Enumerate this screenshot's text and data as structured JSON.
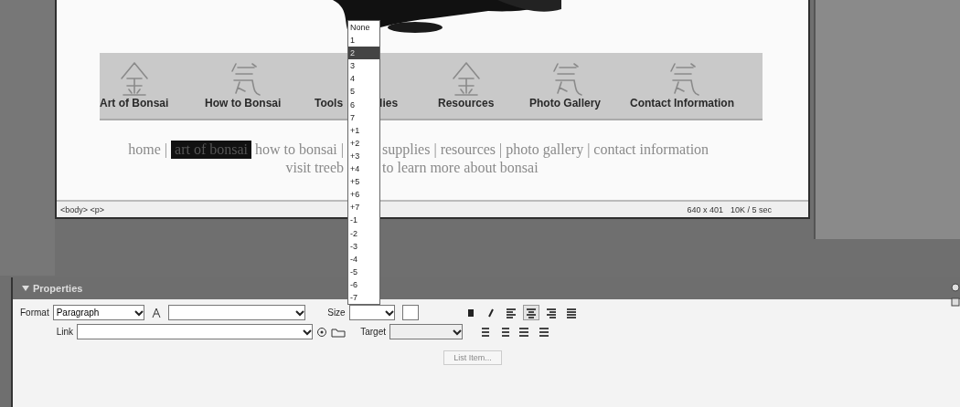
{
  "document": {
    "nav": [
      {
        "label": "Art of Bonsai"
      },
      {
        "label": "How to Bonsai"
      },
      {
        "label": "Tools",
        "tail": "lies"
      },
      {
        "label": "Resources"
      },
      {
        "label": "Photo Gallery"
      },
      {
        "label": "Contact Information"
      }
    ],
    "links_line_1": {
      "before_dropdown": [
        {
          "text": "home |",
          "highlighted": false
        },
        {
          "text": "art of bonsai",
          "highlighted": true
        },
        {
          "text": "how to bonsai |",
          "highlighted": false
        }
      ],
      "after_dropdown": "supplies | resources | photo gallery | contact information"
    },
    "links_line_2": {
      "before_dropdown": "visit treeb",
      "after_dropdown": "to learn more about bonsai"
    },
    "status_bar": {
      "tags": "<body> <p>",
      "dimensions": "640 x 401",
      "download": "10K / 5 sec"
    }
  },
  "size_dropdown": {
    "options": [
      {
        "label": "None",
        "selected": false
      },
      {
        "label": "1",
        "selected": false
      },
      {
        "label": "2",
        "selected": true
      },
      {
        "label": "3",
        "selected": false
      },
      {
        "label": "4",
        "selected": false
      },
      {
        "label": "5",
        "selected": false
      },
      {
        "label": "6",
        "selected": false
      },
      {
        "label": "7",
        "selected": false
      },
      {
        "label": "+1",
        "selected": false
      },
      {
        "label": "+2",
        "selected": false
      },
      {
        "label": "+3",
        "selected": false
      },
      {
        "label": "+4",
        "selected": false
      },
      {
        "label": "+5",
        "selected": false
      },
      {
        "label": "+6",
        "selected": false
      },
      {
        "label": "+7",
        "selected": false
      },
      {
        "label": "-1",
        "selected": false
      },
      {
        "label": "-2",
        "selected": false
      },
      {
        "label": "-3",
        "selected": false
      },
      {
        "label": "-4",
        "selected": false
      },
      {
        "label": "-5",
        "selected": false
      },
      {
        "label": "-6",
        "selected": false
      },
      {
        "label": "-7",
        "selected": false
      }
    ]
  },
  "properties": {
    "title": "Properties",
    "format_label": "Format",
    "format_value": "Paragraph",
    "size_label": "Size",
    "link_label": "Link",
    "target_label": "Target",
    "list_item_button": "List Item...",
    "align": [
      {
        "kind": "left",
        "selected": false
      },
      {
        "kind": "center",
        "selected": true
      },
      {
        "kind": "right",
        "selected": false
      },
      {
        "kind": "justify",
        "selected": false
      }
    ]
  }
}
